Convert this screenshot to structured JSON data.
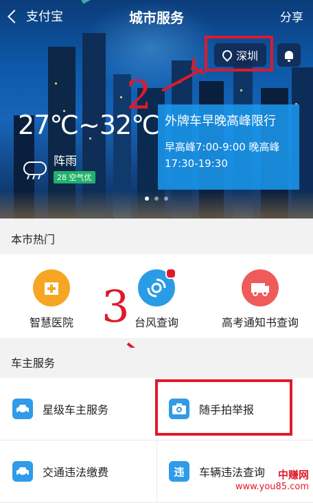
{
  "nav": {
    "back_label": "支付宝",
    "title": "城市服务",
    "share_label": "分享"
  },
  "location": {
    "city": "深圳"
  },
  "weather": {
    "temp_range": "27℃~32℃",
    "desc": "阵雨",
    "aqi": "28 空气优"
  },
  "traffic": {
    "title": "外牌车早晚高峰限行",
    "detail": "早高峰7:00-9:00 晚高峰17:30-19:30"
  },
  "annotations": {
    "num2": "2",
    "num3": "3"
  },
  "hot_section": {
    "header": "本市热门",
    "items": [
      {
        "label": "智慧医院",
        "icon": "hospital-icon",
        "color": "#f6a623"
      },
      {
        "label": "台风查询",
        "icon": "typhoon-icon",
        "color": "#2a9ce6"
      },
      {
        "label": "高考通知书查询",
        "icon": "exam-notice-icon",
        "color": "#ef5b5b"
      }
    ]
  },
  "car_section": {
    "header": "车主服务",
    "items": [
      {
        "label": "星级车主服务",
        "icon": "car-icon"
      },
      {
        "label": "随手拍举报",
        "icon": "camera-icon"
      },
      {
        "label": "交通违法缴费",
        "icon": "car-icon"
      },
      {
        "label": "车辆违法查询",
        "icon": "violation-icon",
        "glyph": "违"
      }
    ]
  },
  "watermark": {
    "line1": "中赚网",
    "line2": "www.you85.com"
  },
  "colors": {
    "annotation_red": "#e0192a",
    "traffic_blue": "#1a96eb",
    "aqi_green": "#23b26b"
  }
}
